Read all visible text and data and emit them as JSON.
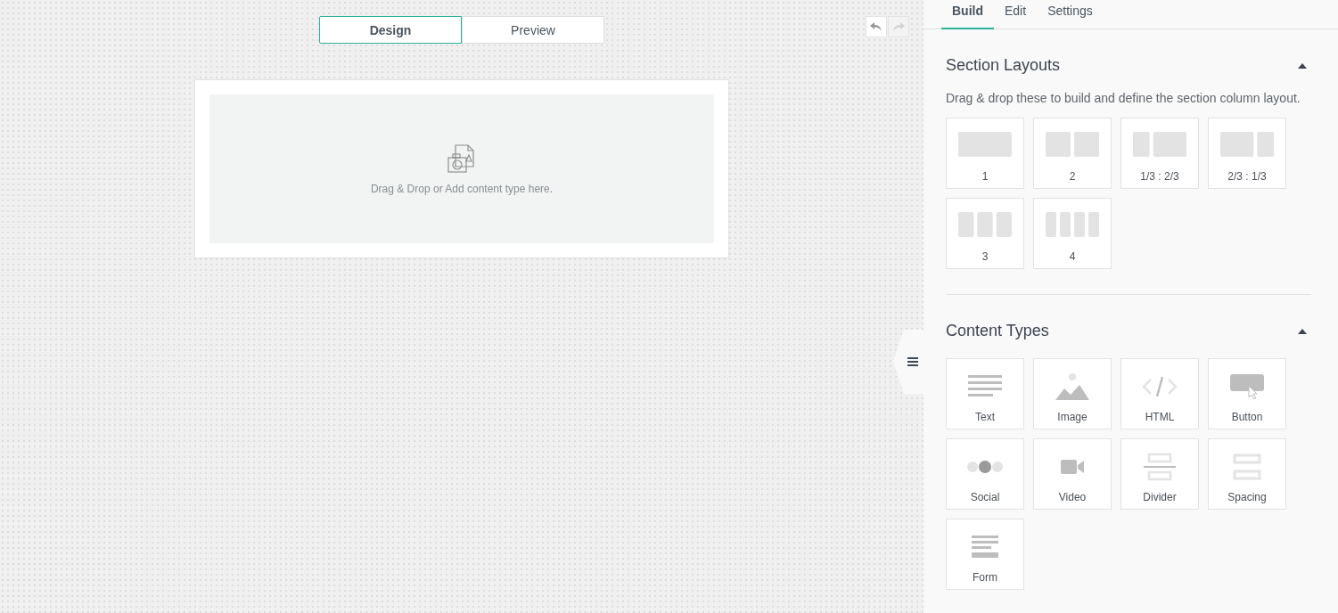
{
  "mode_tabs": [
    {
      "label": "Design",
      "selected": true
    },
    {
      "label": "Preview",
      "selected": false
    }
  ],
  "history": {
    "undo_disabled": false,
    "redo_disabled": true
  },
  "drop_zone": {
    "text": "Drag & Drop or Add content type here."
  },
  "sidebar": {
    "tabs": [
      {
        "label": "Build",
        "selected": true
      },
      {
        "label": "Edit",
        "selected": false
      },
      {
        "label": "Settings",
        "selected": false
      }
    ],
    "sections": [
      {
        "title": "Section Layouts",
        "expanded": true,
        "description": "Drag & drop these to build and define the section column layout.",
        "items": [
          {
            "label": "1",
            "kind": "one"
          },
          {
            "label": "2",
            "kind": "halves"
          },
          {
            "label": "1/3 : 2/3",
            "kind": "third-twothirds"
          },
          {
            "label": "2/3 : 1/3",
            "kind": "twothirds-third"
          },
          {
            "label": "3",
            "kind": "thirds"
          },
          {
            "label": "4",
            "kind": "quarters"
          }
        ]
      },
      {
        "title": "Content Types",
        "expanded": true,
        "items": [
          {
            "label": "Text",
            "kind": "text"
          },
          {
            "label": "Image",
            "kind": "image"
          },
          {
            "label": "HTML",
            "kind": "html"
          },
          {
            "label": "Button",
            "kind": "button"
          },
          {
            "label": "Social",
            "kind": "social"
          },
          {
            "label": "Video",
            "kind": "video"
          },
          {
            "label": "Divider",
            "kind": "divider"
          },
          {
            "label": "Spacing",
            "kind": "spacing"
          },
          {
            "label": "Form",
            "kind": "form"
          }
        ]
      }
    ]
  }
}
